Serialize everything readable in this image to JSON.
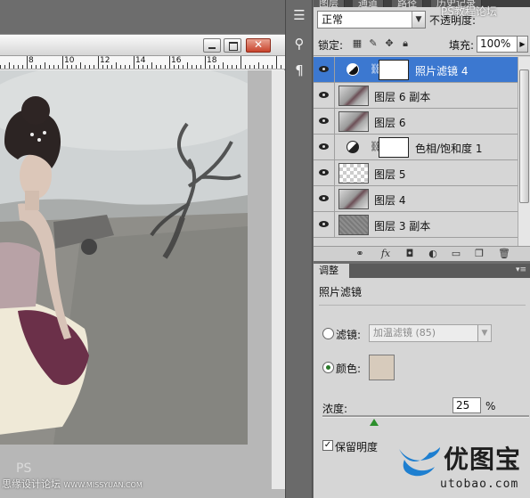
{
  "document_window": {
    "ruler_numbers": [
      "8",
      "10",
      "12",
      "14",
      "16",
      "18"
    ]
  },
  "toolbar": {
    "icons": [
      "sliders-icon",
      "puppet-icon",
      "text-options-icon"
    ]
  },
  "layers_panel": {
    "tabs": [
      "图层",
      "通道",
      "路径",
      "历史记录"
    ],
    "blend_mode": "正常",
    "opacity_label": "不透明度:",
    "lock_label": "锁定:",
    "fill_label": "填充:",
    "fill_value": "100%",
    "layers": [
      {
        "name": "照片滤镜 4",
        "type": "adjustment",
        "selected": true
      },
      {
        "name": "图层 6 副本",
        "type": "photo",
        "selected": false
      },
      {
        "name": "图层 6",
        "type": "photo",
        "selected": false
      },
      {
        "name": "色相/饱和度 1",
        "type": "adjustment",
        "selected": false
      },
      {
        "name": "图层 5",
        "type": "transparent",
        "selected": false
      },
      {
        "name": "图层 4",
        "type": "photo",
        "selected": false
      },
      {
        "name": "图层 3 副本",
        "type": "gray",
        "selected": false
      }
    ]
  },
  "adjustments_panel": {
    "tab_label": "调整",
    "title": "照片滤镜",
    "filter_label": "滤镜:",
    "filter_value": "加温滤镜 (85)",
    "color_label": "颜色:",
    "color_value": "#d7cbbc",
    "density_label": "浓度:",
    "density_value": "25",
    "density_unit": "%",
    "density_fraction": 0.25,
    "preserve_label": "保留明度",
    "preserve_checked": true
  },
  "watermarks": {
    "top": "PS教程论坛",
    "bottom_main": "思缘设计论坛",
    "bottom_url": "WWW.MISSYUAN.COM",
    "logo_text": "优图宝",
    "logo_sub": "utobao.com"
  },
  "colors": {
    "selection_blue": "#3c78d0",
    "panel_gray": "#d6d6d6"
  }
}
